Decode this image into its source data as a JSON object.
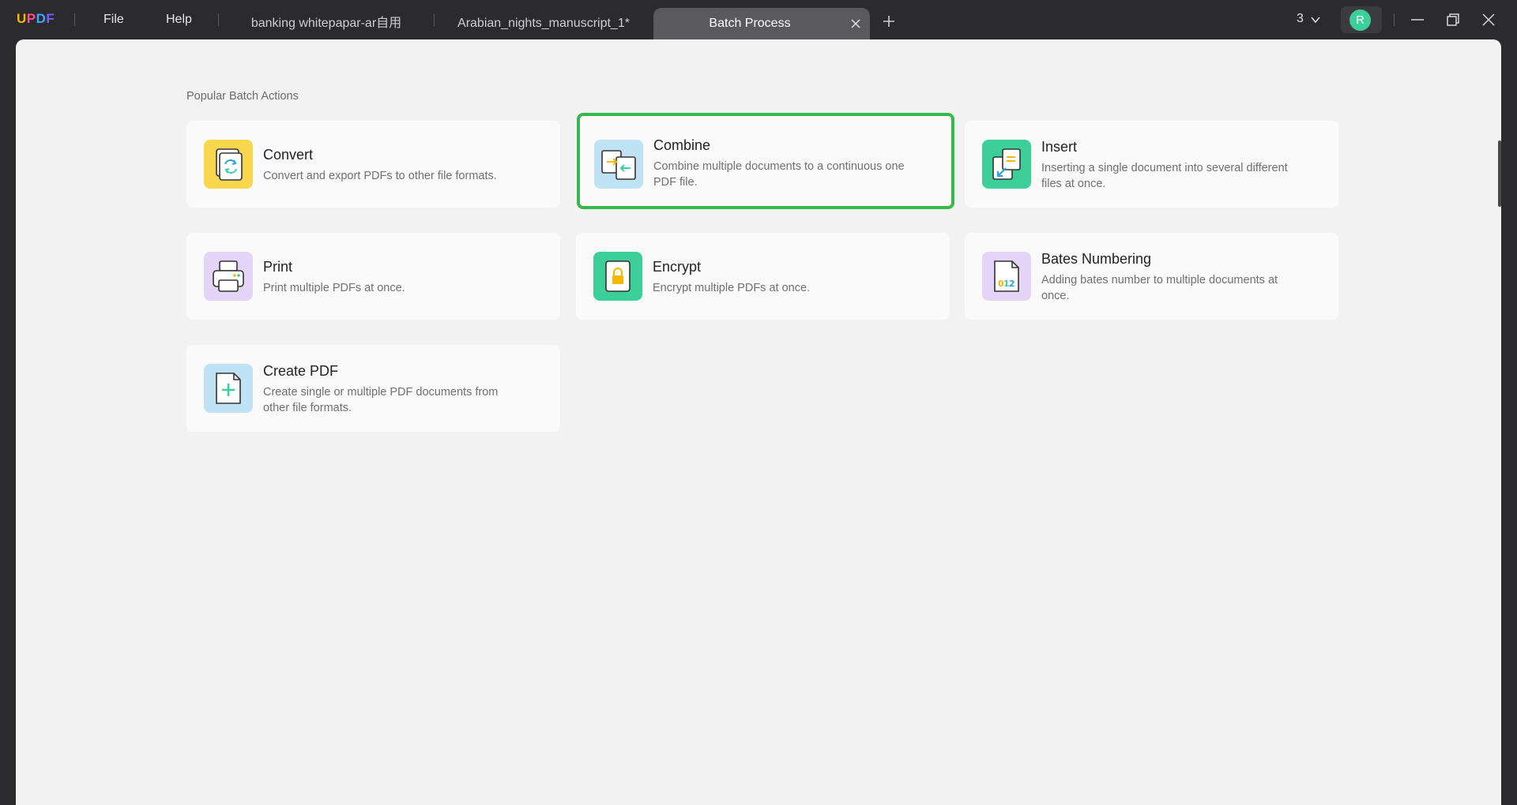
{
  "app": {
    "logo_letters": [
      "U",
      "P",
      "D",
      "F"
    ]
  },
  "menu": {
    "file": "File",
    "help": "Help"
  },
  "tabs": [
    {
      "label": "banking whitepapar-ar自用"
    },
    {
      "label": "Arabian_nights_manuscript_1*"
    },
    {
      "label": "Batch Process",
      "active": true
    }
  ],
  "window": {
    "doc_count": "3",
    "avatar_letter": "R"
  },
  "main": {
    "section_title": "Popular Batch Actions",
    "actions": [
      {
        "title": "Convert",
        "desc": "Convert and export PDFs to other file formats.",
        "icon": "convert-icon",
        "color": "#f8d64e"
      },
      {
        "title": "Combine",
        "desc": "Combine multiple documents to a continuous one PDF file.",
        "icon": "combine-icon",
        "color": "#bfe3f5",
        "selected": true
      },
      {
        "title": "Insert",
        "desc": "Inserting a single document into several different files at once.",
        "icon": "insert-icon",
        "color": "#3ccf9c"
      },
      {
        "title": "Print",
        "desc": "Print multiple PDFs at once.",
        "icon": "print-icon",
        "color": "#e4d4f7"
      },
      {
        "title": "Encrypt",
        "desc": "Encrypt multiple PDFs at once.",
        "icon": "lock-icon",
        "color": "#3ccf9c"
      },
      {
        "title": "Bates Numbering",
        "desc": "Adding bates number to multiple documents at once.",
        "icon": "bates-numbering-icon",
        "color": "#e4d4f7"
      },
      {
        "title": "Create PDF",
        "desc": "Create single or multiple PDF documents from other file formats.",
        "icon": "create-pdf-icon",
        "color": "#bfe3f5"
      }
    ]
  },
  "colors": {
    "selected_border": "#36b94a",
    "avatar": "#3ccf9c"
  }
}
